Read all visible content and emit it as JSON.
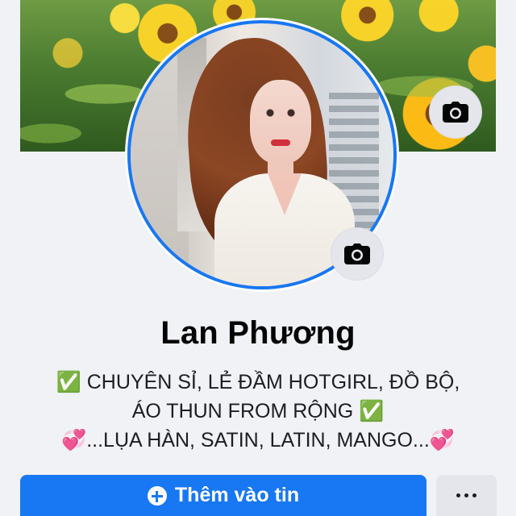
{
  "profile": {
    "name": "Lan Phương",
    "bio_lines": [
      "✅ CHUYÊN SỈ, LẺ  ĐẦM HOTGIRL, ĐỒ BỘ,",
      "ÁO THUN FROM RỘNG ✅",
      "💞...LỤA HÀN, SATIN, LATIN, MANGO...💞"
    ]
  },
  "actions": {
    "primary_label": "Thêm vào tin"
  },
  "icons": {
    "cover_camera": "camera-icon",
    "avatar_camera": "camera-icon",
    "primary_action": "plus-circle-icon",
    "more_action": "more-horizontal-icon"
  },
  "colors": {
    "background": "#f0f2f5",
    "accent": "#1877f2",
    "button_gray": "#e4e6eb",
    "text_primary": "#050505"
  }
}
